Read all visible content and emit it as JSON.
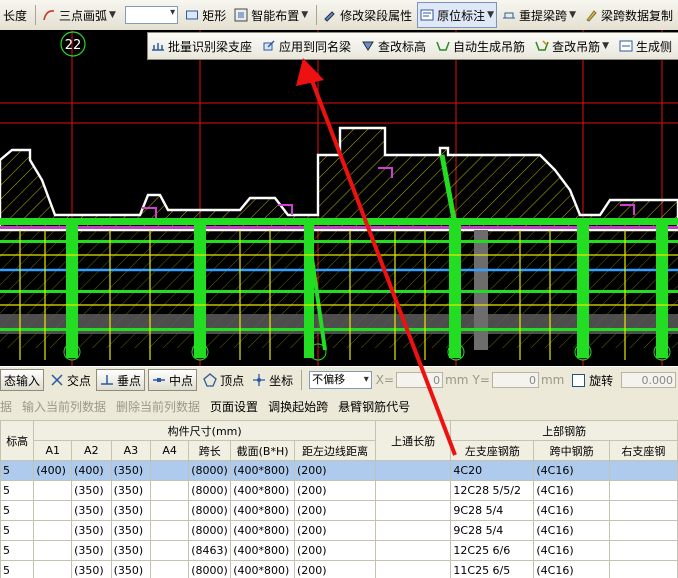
{
  "toolbar1": {
    "length_label": "长度",
    "arc_label": "三点画弧",
    "rect_label": "矩形",
    "smart_layout_label": "智能布置",
    "modify_span_label": "修改梁段属性",
    "in_place_label": "原位标注",
    "re_extract_label": "重提梁跨",
    "span_copy_label": "梁跨数据复制"
  },
  "popup_menu": {
    "items": [
      "批量识别梁支座",
      "应用到同名梁",
      "查改标高",
      "自动生成吊筋",
      "查改吊筋",
      "生成侧"
    ]
  },
  "canvas": {
    "axis_label": "22"
  },
  "toolbar2": {
    "input_label": "态输入",
    "intersection_label": "交点",
    "perpendicular_label": "垂点",
    "midpoint_label": "中点",
    "vertex_label": "顶点",
    "coordinate_label": "坐标",
    "offset_select": "不偏移",
    "x_label": "X=",
    "x_value": "0",
    "y_label": "Y=",
    "y_value": "0",
    "unit": "mm",
    "rotate_label": "旋转",
    "rotate_value": "0.000"
  },
  "toolbar3": {
    "items": [
      "据",
      "输入当前列数据",
      "删除当前列数据",
      "页面设置",
      "调换起始跨",
      "悬臂钢筋代号"
    ],
    "disabled": [
      true,
      true,
      true,
      false,
      false,
      false
    ]
  },
  "grid": {
    "group_size": "构件尺寸(mm)",
    "group_top_through": "上通长筋",
    "group_top_rebar": "上部钢筋",
    "columns": [
      "标高",
      "A1",
      "A2",
      "A3",
      "A4",
      "跨长",
      "截面(B*H)",
      "距左边线距离",
      "左支座钢筋",
      "跨中钢筋",
      "右支座钢"
    ],
    "rows": [
      [
        "5",
        "(400)",
        "(400)",
        "(350)",
        "",
        "(8000)",
        "(400*800)",
        "(200)",
        "",
        "4C20",
        "(4C16)",
        ""
      ],
      [
        "5",
        "",
        "(350)",
        "(350)",
        "",
        "(8000)",
        "(400*800)",
        "(200)",
        "",
        "12C28 5/5/2",
        "(4C16)",
        ""
      ],
      [
        "5",
        "",
        "(350)",
        "(350)",
        "",
        "(8000)",
        "(400*800)",
        "(200)",
        "",
        "9C28 5/4",
        "(4C16)",
        ""
      ],
      [
        "5",
        "",
        "(350)",
        "(350)",
        "",
        "(8000)",
        "(400*800)",
        "(200)",
        "",
        "9C28 5/4",
        "(4C16)",
        ""
      ],
      [
        "5",
        "",
        "(350)",
        "(350)",
        "",
        "(8463)",
        "(400*800)",
        "(200)",
        "",
        "12C25 6/6",
        "(4C16)",
        ""
      ],
      [
        "5",
        "",
        "(350)",
        "(350)",
        "",
        "(8000)",
        "(400*800)",
        "(200)",
        "",
        "11C25 6/5",
        "(4C16)",
        ""
      ]
    ]
  },
  "colors": {
    "canvas_bg": "#000000",
    "beam_green": "#22dd22",
    "rebar_yellow": "#e8e800",
    "axis_red": "#e01010",
    "outline_white": "#ffffff",
    "selection_row": "#aecbee",
    "arrow_red": "#ee1111"
  }
}
